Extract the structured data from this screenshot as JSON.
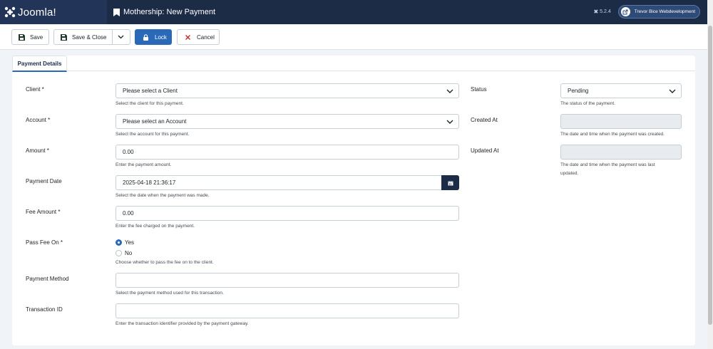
{
  "header": {
    "brand": "Joomla!",
    "page_title": "Mothership: New Payment",
    "version": "5.2.4",
    "site_name": "Trevor Bice Webdevelopment"
  },
  "toolbar": {
    "save_label": "Save",
    "save_close_label": "Save & Close",
    "lock_label": "Lock",
    "cancel_label": "Cancel"
  },
  "tabs": [
    {
      "label": "Payment Details"
    }
  ],
  "form": {
    "client": {
      "label": "Client *",
      "value": "Please select a Client",
      "help": "Select the client for this payment."
    },
    "account": {
      "label": "Account *",
      "value": "Please select an Account",
      "help": "Select the account for this payment."
    },
    "amount": {
      "label": "Amount *",
      "value": "0.00",
      "help": "Enter the payment amount."
    },
    "payment_date": {
      "label": "Payment Date",
      "value": "2025-04-18 21:36:17",
      "help": "Select the date when the payment was made."
    },
    "fee_amount": {
      "label": "Fee Amount *",
      "value": "0.00",
      "help": "Enter the fee charged on the payment."
    },
    "pass_fee_on": {
      "label": "Pass Fee On *",
      "options": [
        "Yes",
        "No"
      ],
      "selected": "Yes",
      "help": "Choose whether to pass the fee on to the client."
    },
    "payment_method": {
      "label": "Payment Method",
      "value": "",
      "help": "Select the payment method used for this transaction."
    },
    "transaction_id": {
      "label": "Transaction ID",
      "value": "",
      "help": "Enter the transaction identifier provided by the payment gateway."
    },
    "status": {
      "label": "Status",
      "value": "Pending",
      "help": "The status of the payment."
    },
    "created_at": {
      "label": "Created At",
      "value": "",
      "help": "The date and time when the payment was created."
    },
    "updated_at": {
      "label": "Updated At",
      "value": "",
      "help_line1": "The date and time when the payment was last",
      "help_line2": "updated."
    }
  },
  "colors": {
    "header_bg": "#1c2c47",
    "accent": "#2a69b8",
    "cancel_red": "#c52827"
  }
}
